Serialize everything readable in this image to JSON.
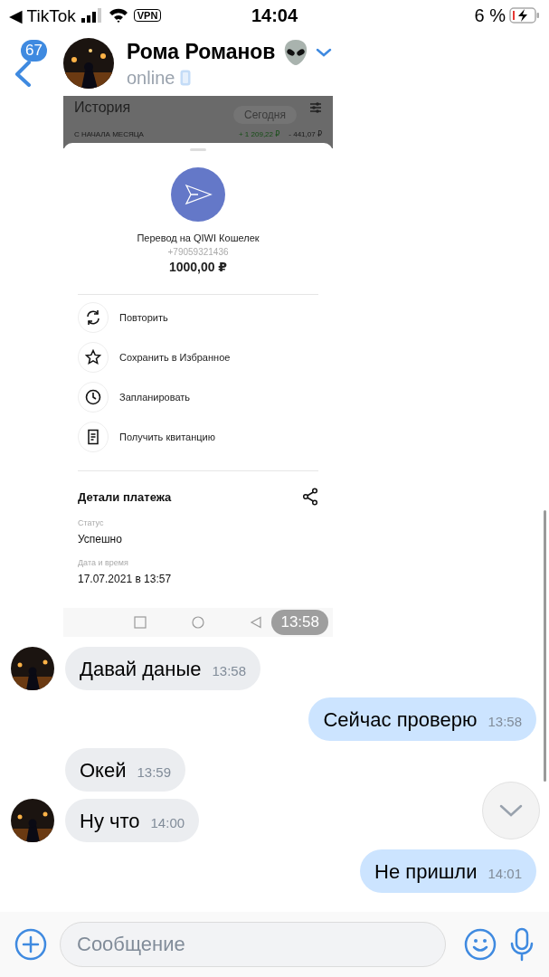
{
  "status_bar": {
    "back_arrow": "◀",
    "back_app": "TikTok",
    "vpn": "VPN",
    "time": "14:04",
    "battery": "6 %",
    "charging": true
  },
  "header": {
    "unread_count": "67",
    "name": "Рома Романов",
    "status": "online"
  },
  "attachment": {
    "history_title": "История",
    "today_button": "Сегодня",
    "period_label": "С НАЧАЛА МЕСЯЦА",
    "income": "+ 1 209,22 ₽",
    "expense": "- 441,07 ₽",
    "transfer_title": "Перевод на QIWI Кошелек",
    "phone": "+79059321436",
    "amount": "1000,00 ₽",
    "actions": [
      {
        "kind": "repeat",
        "label": "Повторить"
      },
      {
        "kind": "favorite",
        "label": "Сохранить в Избранное"
      },
      {
        "kind": "schedule",
        "label": "Запланировать"
      },
      {
        "kind": "receipt",
        "label": "Получить квитанцию"
      }
    ],
    "details_title": "Детали платежа",
    "fields": [
      {
        "label": "Статус",
        "value": "Успешно"
      },
      {
        "label": "Дата и время",
        "value": "17.07.2021 в 13:57"
      }
    ],
    "time": "13:58"
  },
  "messages": [
    {
      "kind": "incoming",
      "avatar": true,
      "text": "Давай даные",
      "time": "13:58"
    },
    {
      "kind": "outgoing",
      "text": "Сейчас проверю",
      "time": "13:58"
    },
    {
      "kind": "incoming",
      "avatar": false,
      "text": "Окей",
      "time": "13:59"
    },
    {
      "kind": "incoming",
      "avatar": true,
      "text": "Ну что",
      "time": "14:00"
    },
    {
      "kind": "outgoing",
      "text": "Не пришли",
      "time": "14:01"
    }
  ],
  "composer": {
    "placeholder": "Сообщение"
  }
}
